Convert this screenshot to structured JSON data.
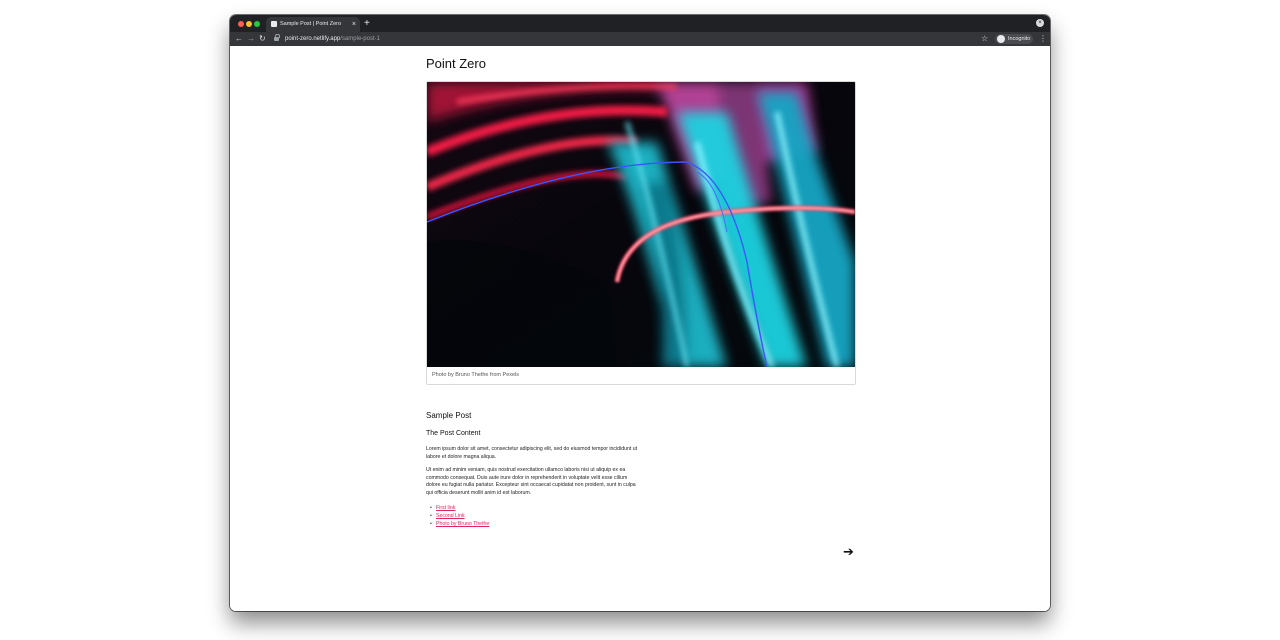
{
  "browser": {
    "tab": {
      "title": "Sample Post | Point Zero",
      "close_glyph": "×"
    },
    "new_tab_glyph": "+",
    "window_close_glyph": "×",
    "nav": {
      "back_glyph": "←",
      "forward_glyph": "→",
      "reload_glyph": "↻"
    },
    "address": {
      "host": "point-zero.netlify.app",
      "path": "/sample-post-1"
    },
    "bookmark_glyph": "☆",
    "profile_label": "Incognito",
    "menu_glyph": "⋮"
  },
  "site": {
    "title": "Point Zero"
  },
  "figure": {
    "caption": "Photo by Bruno Thethe from Pexels"
  },
  "post": {
    "title": "Sample Post",
    "section_heading": "The Post Content",
    "paragraphs": [
      "Lorem ipsum dolor sit amet, consectetur adipiscing elit, sed do eiusmod tempor incididunt ut labore et dolore magna aliqua.",
      "Ut enim ad minim veniam, quis nostrud exercitation ullamco laboris nisi ut aliquip ex ea commodo consequat. Duis aute irure dolor in reprehenderit in voluptate velit esse cillum dolore eu fugiat nulla pariatur. Excepteur sint occaecat cupidatat non proident, sunt in culpa qui officia deserunt mollit anim id est laborum."
    ],
    "links": [
      "First link",
      "Second Link",
      "Photo by Bruno Thethe"
    ]
  },
  "pagination": {
    "next_glyph": "➔"
  },
  "colors": {
    "link": "#e0245e",
    "tabbar": "#202124",
    "toolbar": "#35363a"
  }
}
